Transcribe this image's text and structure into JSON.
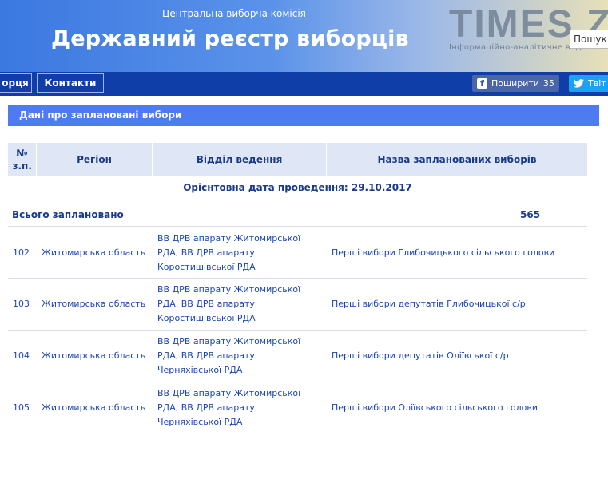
{
  "header": {
    "org": "Центральна виборча комісія",
    "title": "Державний реєстр виборців",
    "watermark_main": "TIMES.ZT",
    "watermark_sub": "Інформаційно-аналітичне видання",
    "search_placeholder": "Пошук..."
  },
  "nav": {
    "item_partial": "орця",
    "contacts": "Контакти",
    "share_label": "Поширити",
    "share_count": "35",
    "tweet_label": "Твіт"
  },
  "section": {
    "title": "Дані про заплановані вибори"
  },
  "table": {
    "headers": {
      "num": "№ з.п.",
      "region": "Регіон",
      "dept": "Відділ ведення",
      "name": "Назва запланованих виборів"
    },
    "date_line": "Орієнтовна дата проведення: 29.10.2017",
    "total_label": "Всього заплановано",
    "total_value": "565",
    "rows": [
      {
        "num": "102",
        "region": "Житомирська область",
        "dept": [
          "ВВ ДРВ апарату Житомирської",
          "РДА, ВВ ДРВ апарату",
          "Коростишівської РДА"
        ],
        "name": "Перші вибори Глибочицького сільського голови"
      },
      {
        "num": "103",
        "region": "Житомирська область",
        "dept": [
          "ВВ ДРВ апарату Житомирської",
          "РДА, ВВ ДРВ апарату",
          "Коростишівської РДА"
        ],
        "name": "Перші вибори депутатів Глибочицької с/р"
      },
      {
        "num": "104",
        "region": "Житомирська область",
        "dept": [
          "ВВ ДРВ апарату Житомирської",
          "РДА, ВВ ДРВ апарату",
          "Черняхівської РДА"
        ],
        "name": "Перші вибори депутатів Оліївської с/р"
      },
      {
        "num": "105",
        "region": "Житомирська область",
        "dept": [
          "ВВ ДРВ апарату Житомирської",
          "РДА, ВВ ДРВ апарату",
          "Черняхівської РДА"
        ],
        "name": "Перші вибори Оліївського сільського голови"
      }
    ]
  }
}
